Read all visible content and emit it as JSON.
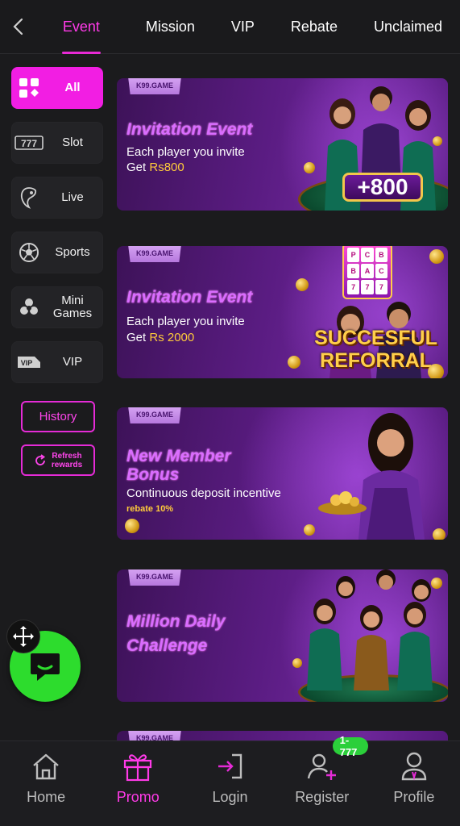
{
  "header": {
    "back_label": "<",
    "tabs": [
      {
        "label": "Event",
        "active": true
      },
      {
        "label": "Mission"
      },
      {
        "label": "VIP"
      },
      {
        "label": "Rebate"
      },
      {
        "label": "Unclaimed"
      }
    ]
  },
  "sidebar": {
    "items": [
      {
        "label": "All",
        "icon": "grid-icon",
        "active": true
      },
      {
        "label": "Slot",
        "icon": "slot-777-icon"
      },
      {
        "label": "Live",
        "icon": "live-dealer-icon"
      },
      {
        "label": "Sports",
        "icon": "soccer-ball-icon"
      },
      {
        "label": "Mini Games",
        "icon": "mini-games-icon"
      },
      {
        "label": "VIP",
        "icon": "vip-icon"
      }
    ],
    "history_label": "History",
    "refresh_label_line1": "Refresh",
    "refresh_label_line2": "rewards"
  },
  "banners": [
    {
      "tag": "K99.GAME",
      "title": "Invitation Event",
      "line1": "Each player you invite",
      "line2_prefix": "Get",
      "line2_amount": "Rs800",
      "badge": "+800"
    },
    {
      "tag": "K99.GAME",
      "title": "Invitation Event",
      "line1": "Each player you invite",
      "line2_prefix": "Get",
      "line2_amount": "Rs 2000",
      "badge_line1": "SUCCESFUL",
      "badge_line2": "REFORRAL"
    },
    {
      "tag": "K99.GAME",
      "title_line1": "New Member",
      "title_line2": "Bonus",
      "line1": "Continuous deposit incentive",
      "small": "rebate 10%"
    },
    {
      "tag": "K99.GAME",
      "title_line1": "Million Daily",
      "title_line2": "Challenge"
    },
    {
      "tag": "K99.GAME"
    }
  ],
  "bottom_nav": [
    {
      "label": "Home",
      "icon": "home-icon"
    },
    {
      "label": "Promo",
      "icon": "gift-icon",
      "active": true
    },
    {
      "label": "Login",
      "icon": "login-icon"
    },
    {
      "label": "Register",
      "icon": "add-user-icon",
      "badge": "1-777"
    },
    {
      "label": "Profile",
      "icon": "profile-icon"
    }
  ],
  "colors": {
    "accent": "#f21ee3",
    "accent_text": "#ff3ae8",
    "background": "#1b1b1d",
    "chat_button": "#2ddc2d",
    "gold": "#ffcb3a"
  }
}
